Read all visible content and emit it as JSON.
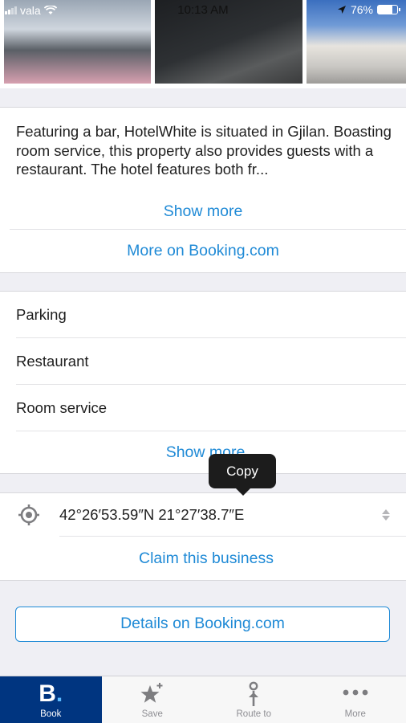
{
  "status_bar": {
    "carrier": "vala",
    "time": "10:13 AM",
    "battery_percent": "76%",
    "battery_level": 0.76
  },
  "description": {
    "text": "Featuring a bar, HotelWhite is situated in Gjilan. Boasting room service, this property also provides guests with a restaurant. The hotel features both fr...",
    "show_more": "Show more",
    "more_on_booking": "More on Booking.com"
  },
  "facilities": {
    "items": [
      "Parking",
      "Restaurant",
      "Room service"
    ],
    "show_more": "Show more"
  },
  "location": {
    "coordinates": "42°26′53.59″N 21°27′38.7″E",
    "copy_tooltip": "Copy",
    "claim_business": "Claim this business"
  },
  "details_button": "Details on Booking.com",
  "tabs": [
    {
      "label": "Book",
      "icon": "booking-b-icon",
      "active": true
    },
    {
      "label": "Save",
      "icon": "star-plus-icon",
      "active": false
    },
    {
      "label": "Route to",
      "icon": "route-pin-icon",
      "active": false
    },
    {
      "label": "More",
      "icon": "more-dots-icon",
      "active": false
    }
  ],
  "colors": {
    "accent": "#1f8ad6",
    "booking_blue": "#003580",
    "background": "#efeff4"
  }
}
